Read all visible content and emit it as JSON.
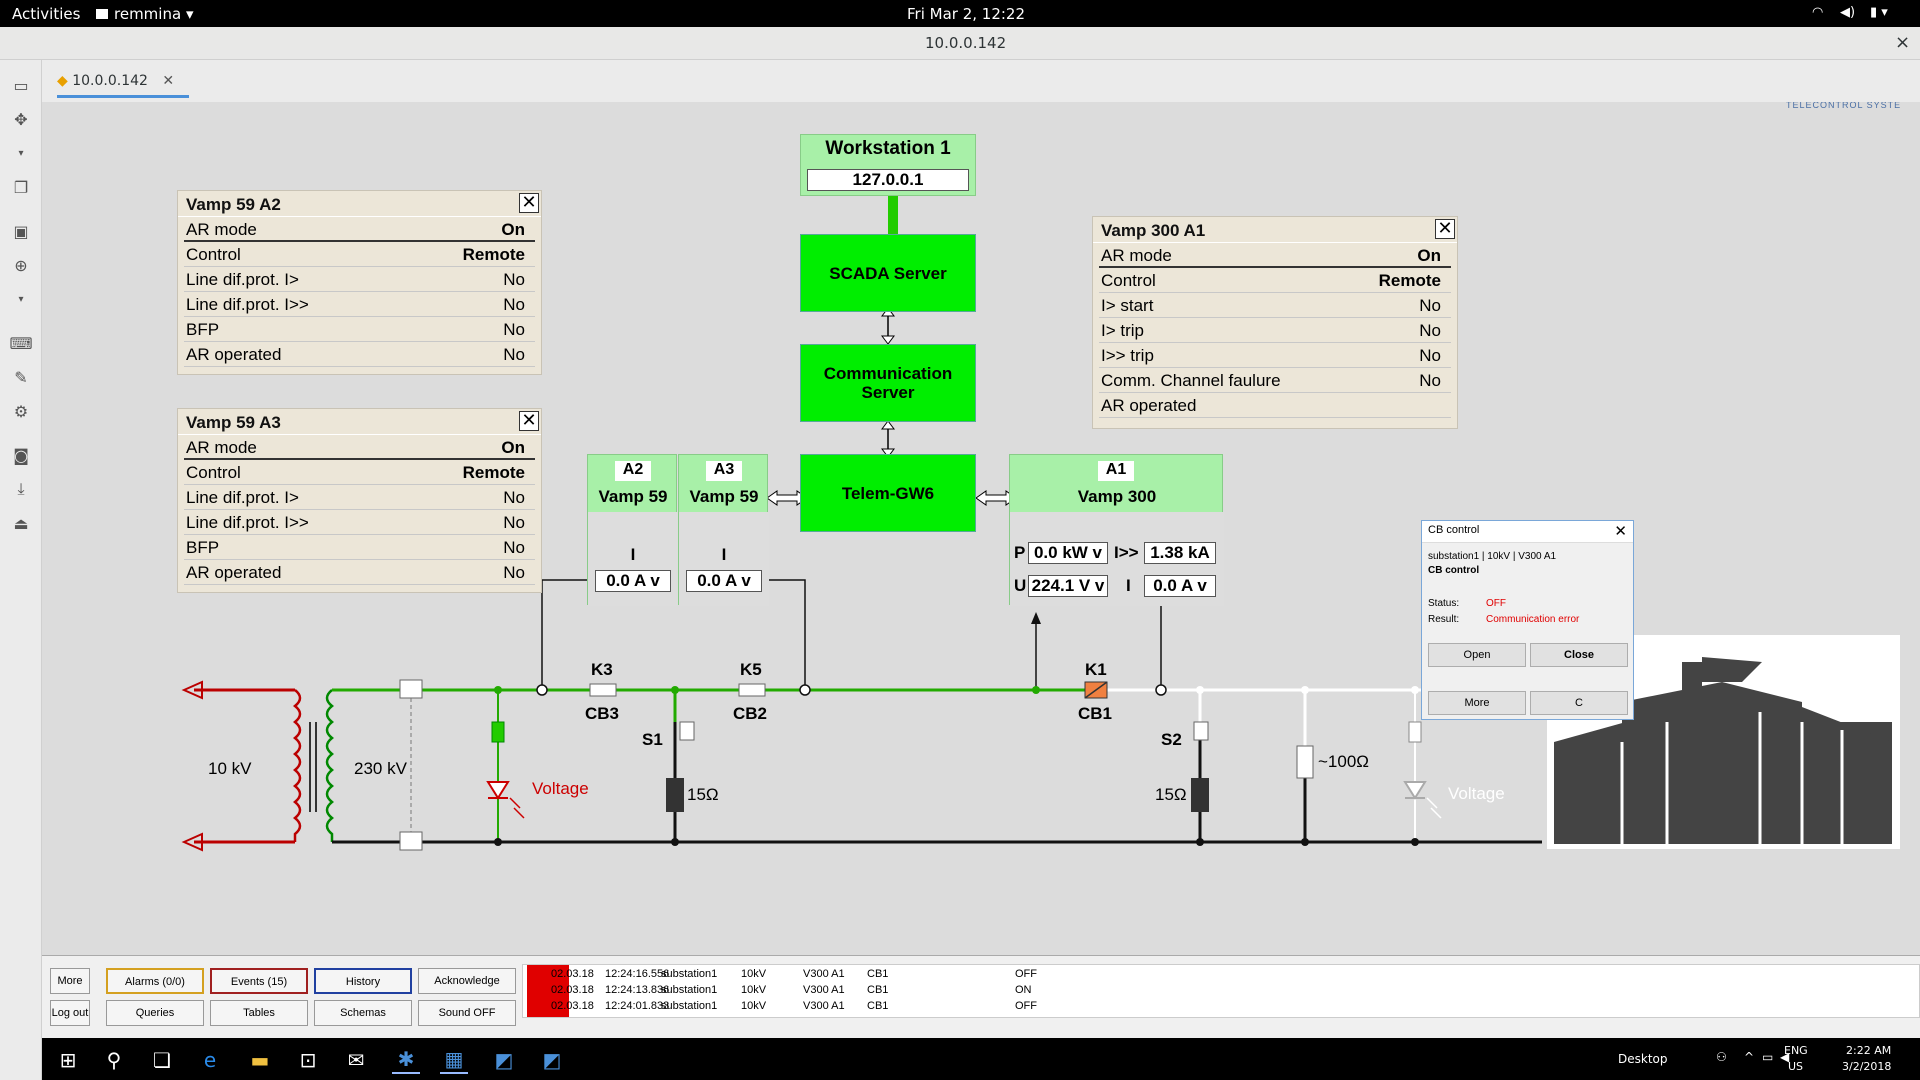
{
  "topbar": {
    "activities": "Activities",
    "app": "remmina",
    "datetime": "Fri Mar 2, 12:22"
  },
  "window": {
    "title": "10.0.0.142",
    "tab": "10.0.0.142",
    "close": "×"
  },
  "scada": {
    "brand": "TELECONTROL SYSTE",
    "workstation": {
      "title": "Workstation 1",
      "ip": "127.0.0.1"
    },
    "scada_server": "SCADA Server",
    "comm_server": "Communication Server",
    "telem": "Telem-GW6",
    "a2": {
      "tag": "A2",
      "name": "Vamp 59",
      "meas_label": "I",
      "meas_value": "0.0 A v"
    },
    "a3": {
      "tag": "A3",
      "name": "Vamp 59",
      "meas_label": "I",
      "meas_value": "0.0 A v"
    },
    "a1": {
      "tag": "A1",
      "name": "Vamp 300",
      "p_label": "P",
      "p_value": "0.0 kW v",
      "i2_label": "I>>",
      "i2_value": "1.38 kA",
      "u_label": "U",
      "u_value": "224.1 V v",
      "i_label": "I",
      "i_value": "0.0 A v"
    },
    "panel_a2": {
      "title": "Vamp 59 A2",
      "rows": [
        {
          "k": "AR mode",
          "v": "On"
        },
        {
          "k": "Control",
          "v": "Remote"
        },
        {
          "k": "Line dif.prot. I>",
          "v": "No"
        },
        {
          "k": "Line dif.prot. I>>",
          "v": "No"
        },
        {
          "k": "BFP",
          "v": "No"
        },
        {
          "k": "AR operated",
          "v": "No"
        }
      ]
    },
    "panel_a3": {
      "title": "Vamp 59 A3",
      "rows": [
        {
          "k": "AR mode",
          "v": "On"
        },
        {
          "k": "Control",
          "v": "Remote"
        },
        {
          "k": "Line dif.prot. I>",
          "v": "No"
        },
        {
          "k": "Line dif.prot. I>>",
          "v": "No"
        },
        {
          "k": "BFP",
          "v": "No"
        },
        {
          "k": "AR operated",
          "v": "No"
        }
      ]
    },
    "panel_a1": {
      "title": "Vamp 300 A1",
      "rows": [
        {
          "k": "AR mode",
          "v": "On"
        },
        {
          "k": "Control",
          "v": "Remote"
        },
        {
          "k": "I> start",
          "v": "No"
        },
        {
          "k": "I> trip",
          "v": "No"
        },
        {
          "k": "I>> trip",
          "v": "No"
        },
        {
          "k": "Comm. Channel faulure",
          "v": "No"
        },
        {
          "k": "AR operated",
          "v": ""
        }
      ]
    },
    "diagram": {
      "v10": "10 kV",
      "v230": "230 kV",
      "k3": "K3",
      "cb3": "CB3",
      "k5": "K5",
      "cb2": "CB2",
      "k1": "K1",
      "cb1": "CB1",
      "s1": "S1",
      "s2": "S2",
      "r1": "15Ω",
      "r2": "15Ω",
      "r3": "~100Ω",
      "voltage1": "Voltage",
      "voltage2": "Voltage"
    },
    "cb_dialog": {
      "title": "CB control",
      "path": "substation1 | 10kV | V300 A1",
      "heading": "CB control",
      "status_label": "Status:",
      "status_value": "OFF",
      "result_label": "Result:",
      "result_value": "Communication error",
      "open": "Open",
      "close": "Close",
      "more": "More",
      "c": "C",
      "status_color": "#e00000"
    }
  },
  "appbar": {
    "buttons_top": [
      "More",
      "Alarms (0/0)",
      "Events (15)",
      "History",
      "Acknowledge"
    ],
    "buttons_bottom": [
      "Log out",
      "Queries",
      "Tables",
      "Schemas",
      "Sound OFF"
    ],
    "events": [
      {
        "date": "02.03.18",
        "time": "12:24:16.556",
        "station": "substation1",
        "level": "10kV",
        "device": "V300 A1",
        "obj": "CB1",
        "state": "OFF"
      },
      {
        "date": "02.03.18",
        "time": "12:24:13.836",
        "station": "substation1",
        "level": "10kV",
        "device": "V300 A1",
        "obj": "CB1",
        "state": "ON"
      },
      {
        "date": "02.03.18",
        "time": "12:24:01.833",
        "station": "substation1",
        "level": "10kV",
        "device": "V300 A1",
        "obj": "CB1",
        "state": "OFF"
      }
    ]
  },
  "taskbar": {
    "desktop": "Desktop",
    "lang1": "ENG",
    "lang2": "US",
    "time": "2:22 AM",
    "date": "3/2/2018"
  },
  "colors": {
    "green_box": "#00ee00",
    "light_green": "#a8f0a8",
    "busbar": "#22aa00",
    "red": "#cc0000",
    "panel_bg": "#ece6d8"
  }
}
